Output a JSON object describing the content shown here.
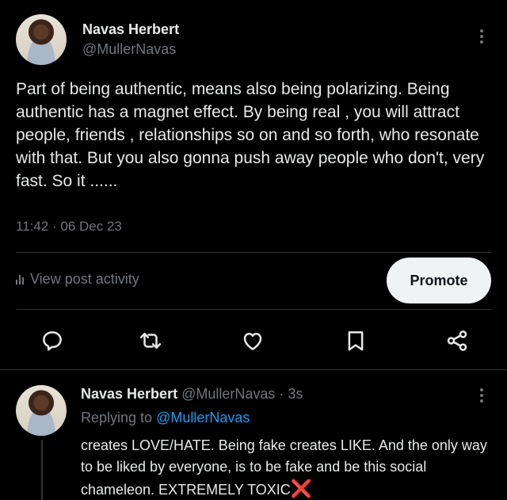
{
  "post": {
    "author_name": "Navas Herbert",
    "author_handle": "@MullerNavas",
    "text": "Part of being authentic, means also being polarizing. Being authentic has a magnet effect. By being real , you will attract people, friends , relationships so on and so forth, who resonate with that. But you also gonna push away people who don't, very fast. So it ......",
    "timestamp": "11:42 · 06 Dec 23",
    "view_activity_label": "View post activity",
    "promote_label": "Promote",
    "actions": [
      "reply-icon",
      "repost-icon",
      "like-icon",
      "bookmark-icon",
      "share-icon"
    ]
  },
  "reply": {
    "author_name": "Navas Herbert",
    "author_handle_time": "@MullerNavas · 3s",
    "replying_prefix": "Replying to",
    "replying_to": "@MullerNavas",
    "text": "creates LOVE/HATE. Being fake creates LIKE. And the only way to be liked by everyone, is to be fake and be this social chameleon. EXTREMELY TOXIC",
    "emoji": "❌"
  },
  "colors": {
    "background": "#000000",
    "text": "#e7e9ea",
    "muted": "#71767b",
    "link": "#1d9bf0",
    "promote_bg": "#eff3f4",
    "cross": "#f4212e"
  }
}
